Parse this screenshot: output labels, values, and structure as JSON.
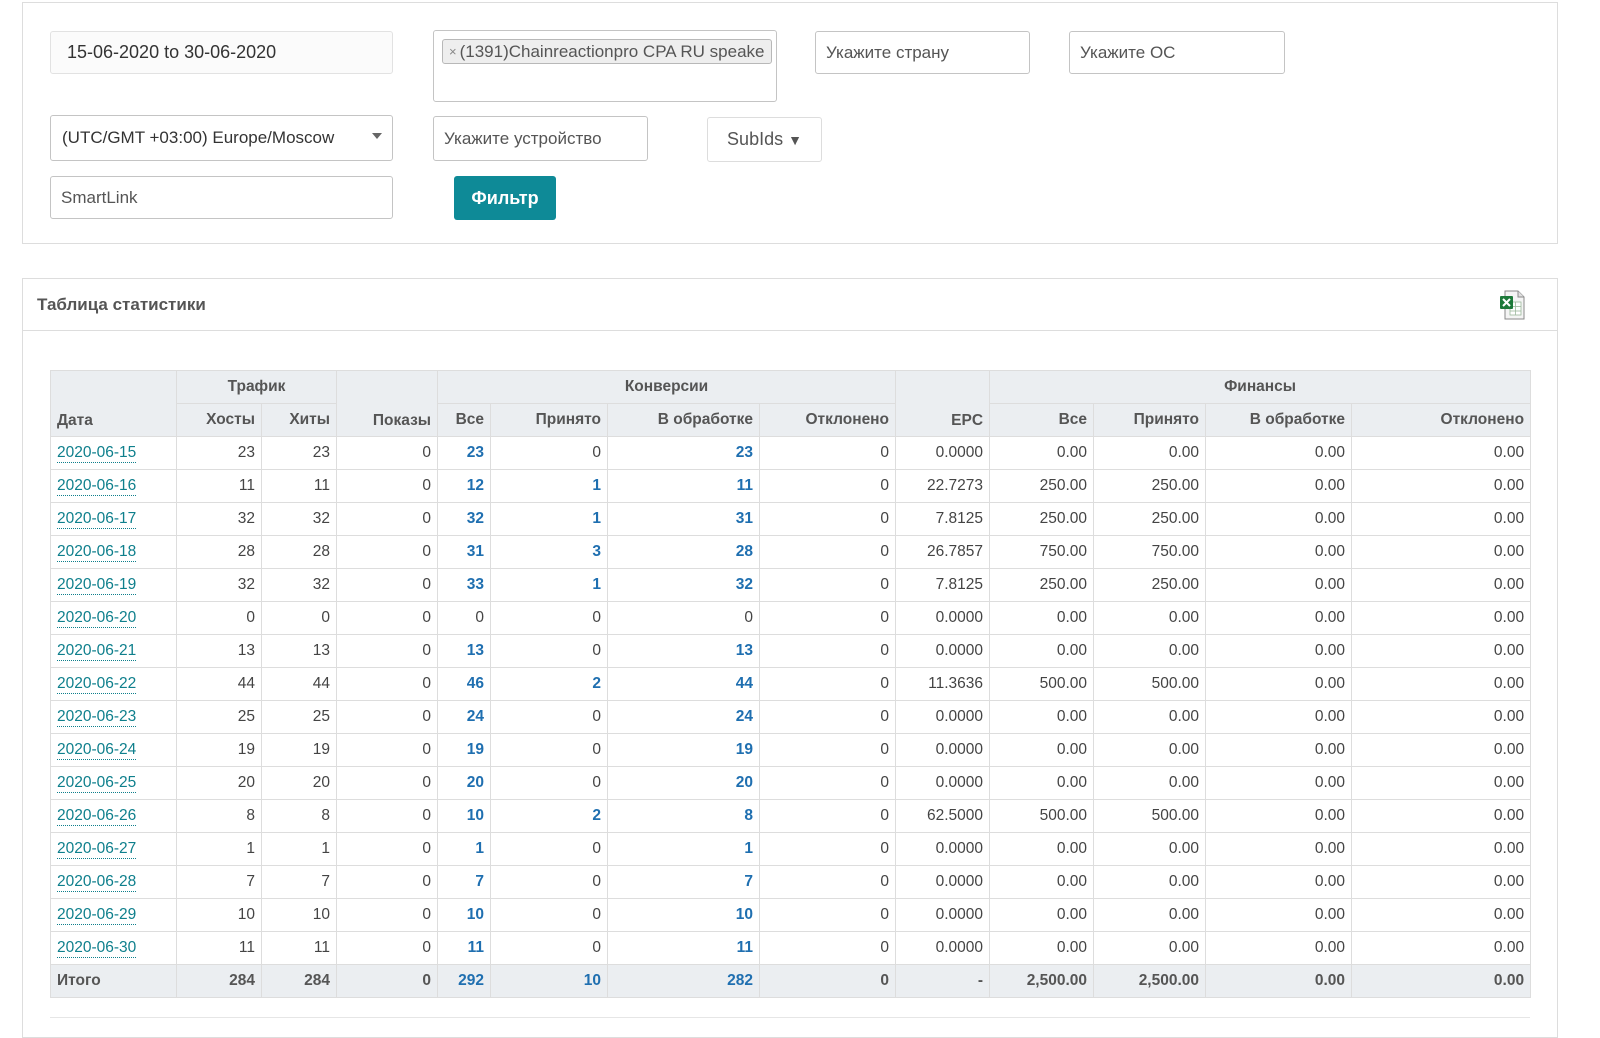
{
  "filters": {
    "date_range": "15-06-2020 to 30-06-2020",
    "offer_tag": "(1391)Chainreactionpro CPA RU speake",
    "country_placeholder": "Укажите страну",
    "os_placeholder": "Укажите ОС",
    "timezone": "(UTC/GMT +03:00) Europe/Moscow",
    "device_placeholder": "Укажите устройство",
    "subids_label": "SubIds",
    "subids_arrow": "▼",
    "smartlink_placeholder": "SmartLink",
    "filter_button": "Фильтр"
  },
  "stats": {
    "title": "Таблица статистики",
    "export_icon": "excel-export-icon",
    "headers": {
      "date": "Дата",
      "traffic": "Трафик",
      "conversions": "Конверсии",
      "finance": "Финансы",
      "hosts": "Хосты",
      "hits": "Хиты",
      "impressions": "Показы",
      "conv_all": "Все",
      "conv_accepted": "Принято",
      "conv_pending": "В обработке",
      "conv_rejected": "Отклонено",
      "epc": "EPC",
      "fin_all": "Все",
      "fin_accepted": "Принято",
      "fin_pending": "В обработке",
      "fin_rejected": "Отклонено"
    },
    "rows": [
      {
        "date": "2020-06-15",
        "hosts": "23",
        "hits": "23",
        "impr": "0",
        "all": "23",
        "acc": "0",
        "pend": "23",
        "rej": "0",
        "epc": "0.0000",
        "f_all": "0.00",
        "f_acc": "0.00",
        "f_pend": "0.00",
        "f_rej": "0.00"
      },
      {
        "date": "2020-06-16",
        "hosts": "11",
        "hits": "11",
        "impr": "0",
        "all": "12",
        "acc": "1",
        "pend": "11",
        "rej": "0",
        "epc": "22.7273",
        "f_all": "250.00",
        "f_acc": "250.00",
        "f_pend": "0.00",
        "f_rej": "0.00"
      },
      {
        "date": "2020-06-17",
        "hosts": "32",
        "hits": "32",
        "impr": "0",
        "all": "32",
        "acc": "1",
        "pend": "31",
        "rej": "0",
        "epc": "7.8125",
        "f_all": "250.00",
        "f_acc": "250.00",
        "f_pend": "0.00",
        "f_rej": "0.00"
      },
      {
        "date": "2020-06-18",
        "hosts": "28",
        "hits": "28",
        "impr": "0",
        "all": "31",
        "acc": "3",
        "pend": "28",
        "rej": "0",
        "epc": "26.7857",
        "f_all": "750.00",
        "f_acc": "750.00",
        "f_pend": "0.00",
        "f_rej": "0.00"
      },
      {
        "date": "2020-06-19",
        "hosts": "32",
        "hits": "32",
        "impr": "0",
        "all": "33",
        "acc": "1",
        "pend": "32",
        "rej": "0",
        "epc": "7.8125",
        "f_all": "250.00",
        "f_acc": "250.00",
        "f_pend": "0.00",
        "f_rej": "0.00"
      },
      {
        "date": "2020-06-20",
        "hosts": "0",
        "hits": "0",
        "impr": "0",
        "all": "0",
        "acc": "0",
        "pend": "0",
        "rej": "0",
        "epc": "0.0000",
        "f_all": "0.00",
        "f_acc": "0.00",
        "f_pend": "0.00",
        "f_rej": "0.00"
      },
      {
        "date": "2020-06-21",
        "hosts": "13",
        "hits": "13",
        "impr": "0",
        "all": "13",
        "acc": "0",
        "pend": "13",
        "rej": "0",
        "epc": "0.0000",
        "f_all": "0.00",
        "f_acc": "0.00",
        "f_pend": "0.00",
        "f_rej": "0.00"
      },
      {
        "date": "2020-06-22",
        "hosts": "44",
        "hits": "44",
        "impr": "0",
        "all": "46",
        "acc": "2",
        "pend": "44",
        "rej": "0",
        "epc": "11.3636",
        "f_all": "500.00",
        "f_acc": "500.00",
        "f_pend": "0.00",
        "f_rej": "0.00"
      },
      {
        "date": "2020-06-23",
        "hosts": "25",
        "hits": "25",
        "impr": "0",
        "all": "24",
        "acc": "0",
        "pend": "24",
        "rej": "0",
        "epc": "0.0000",
        "f_all": "0.00",
        "f_acc": "0.00",
        "f_pend": "0.00",
        "f_rej": "0.00"
      },
      {
        "date": "2020-06-24",
        "hosts": "19",
        "hits": "19",
        "impr": "0",
        "all": "19",
        "acc": "0",
        "pend": "19",
        "rej": "0",
        "epc": "0.0000",
        "f_all": "0.00",
        "f_acc": "0.00",
        "f_pend": "0.00",
        "f_rej": "0.00"
      },
      {
        "date": "2020-06-25",
        "hosts": "20",
        "hits": "20",
        "impr": "0",
        "all": "20",
        "acc": "0",
        "pend": "20",
        "rej": "0",
        "epc": "0.0000",
        "f_all": "0.00",
        "f_acc": "0.00",
        "f_pend": "0.00",
        "f_rej": "0.00"
      },
      {
        "date": "2020-06-26",
        "hosts": "8",
        "hits": "8",
        "impr": "0",
        "all": "10",
        "acc": "2",
        "pend": "8",
        "rej": "0",
        "epc": "62.5000",
        "f_all": "500.00",
        "f_acc": "500.00",
        "f_pend": "0.00",
        "f_rej": "0.00"
      },
      {
        "date": "2020-06-27",
        "hosts": "1",
        "hits": "1",
        "impr": "0",
        "all": "1",
        "acc": "0",
        "pend": "1",
        "rej": "0",
        "epc": "0.0000",
        "f_all": "0.00",
        "f_acc": "0.00",
        "f_pend": "0.00",
        "f_rej": "0.00"
      },
      {
        "date": "2020-06-28",
        "hosts": "7",
        "hits": "7",
        "impr": "0",
        "all": "7",
        "acc": "0",
        "pend": "7",
        "rej": "0",
        "epc": "0.0000",
        "f_all": "0.00",
        "f_acc": "0.00",
        "f_pend": "0.00",
        "f_rej": "0.00"
      },
      {
        "date": "2020-06-29",
        "hosts": "10",
        "hits": "10",
        "impr": "0",
        "all": "10",
        "acc": "0",
        "pend": "10",
        "rej": "0",
        "epc": "0.0000",
        "f_all": "0.00",
        "f_acc": "0.00",
        "f_pend": "0.00",
        "f_rej": "0.00"
      },
      {
        "date": "2020-06-30",
        "hosts": "11",
        "hits": "11",
        "impr": "0",
        "all": "11",
        "acc": "0",
        "pend": "11",
        "rej": "0",
        "epc": "0.0000",
        "f_all": "0.00",
        "f_acc": "0.00",
        "f_pend": "0.00",
        "f_rej": "0.00"
      }
    ],
    "totals": {
      "label": "Итого",
      "hosts": "284",
      "hits": "284",
      "impr": "0",
      "all": "292",
      "acc": "10",
      "pend": "282",
      "rej": "0",
      "epc": "-",
      "f_all": "2,500.00",
      "f_acc": "2,500.00",
      "f_pend": "0.00",
      "f_rej": "0.00"
    }
  }
}
